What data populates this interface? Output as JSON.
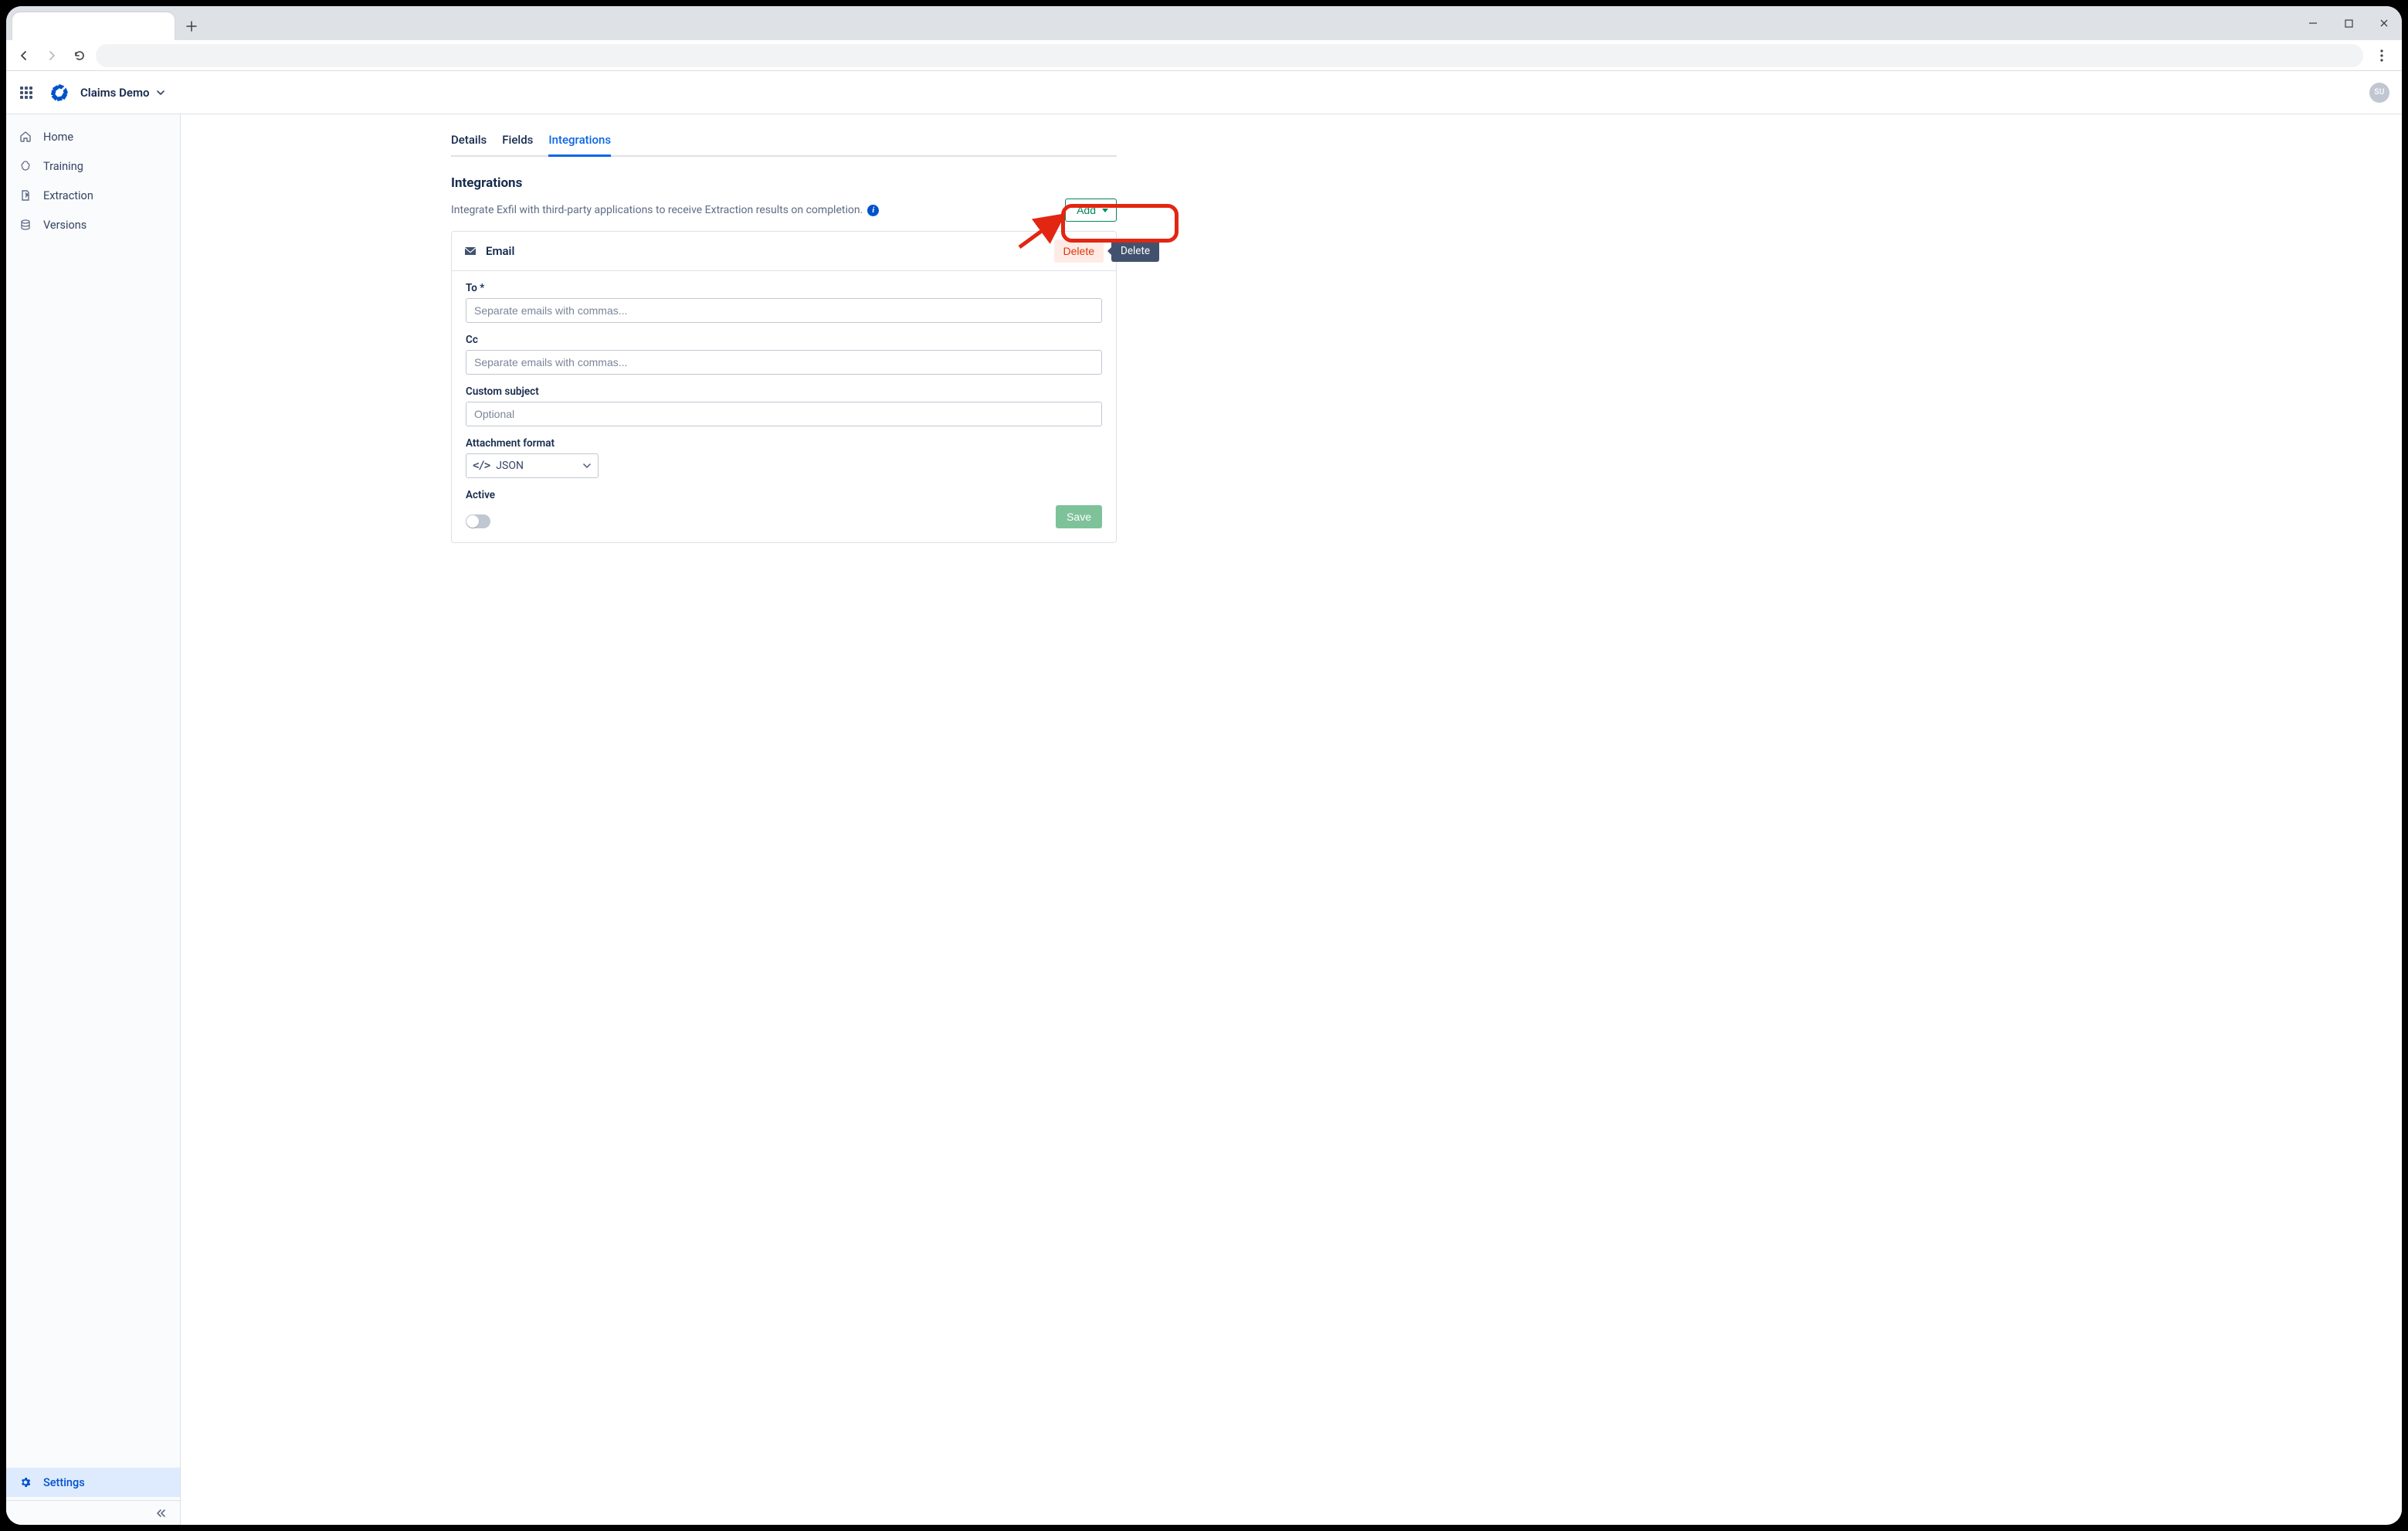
{
  "header": {
    "project_name": "Claims Demo",
    "avatar_initials": "SU"
  },
  "sidebar": {
    "items": [
      {
        "label": "Home"
      },
      {
        "label": "Training"
      },
      {
        "label": "Extraction"
      },
      {
        "label": "Versions"
      }
    ],
    "settings_label": "Settings"
  },
  "tabs": {
    "details": "Details",
    "fields": "Fields",
    "integrations": "Integrations"
  },
  "integrations": {
    "title": "Integrations",
    "description": "Integrate Exfil with third-party applications to receive Extraction results on completion.",
    "add_label": "Add",
    "card": {
      "title": "Email",
      "delete_label": "Delete",
      "delete_tooltip": "Delete",
      "fields": {
        "to_label": "To *",
        "to_placeholder": "Separate emails with commas...",
        "cc_label": "Cc",
        "cc_placeholder": "Separate emails with commas...",
        "subject_label": "Custom subject",
        "subject_placeholder": "Optional",
        "attachment_label": "Attachment format",
        "attachment_value": "JSON",
        "active_label": "Active",
        "save_label": "Save"
      }
    }
  }
}
